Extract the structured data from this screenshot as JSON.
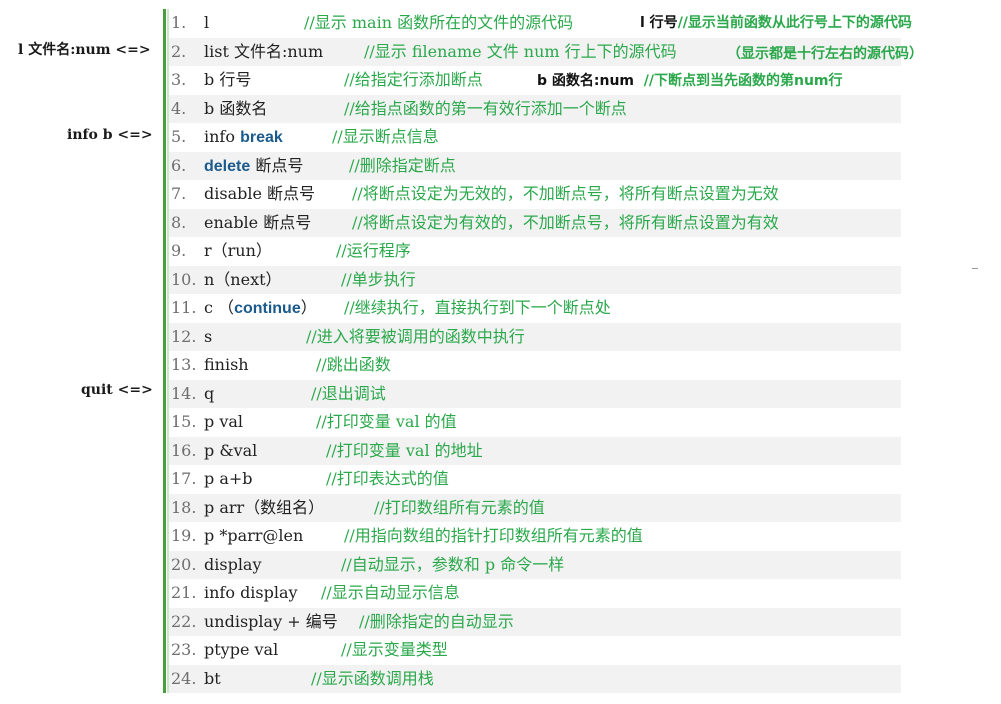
{
  "margin_annotations": {
    "list_alias": "l 文件名:num <=>",
    "info_b_alias": "info b  <=>",
    "quit_alias": "quit  <=>"
  },
  "inline_notes": {
    "line1_cmd": "l  行号",
    "line1_desc": "//显示当前函数从此行号上下的源代码",
    "line2_desc": "（显示都是十行左右的源代码）",
    "line3_cmd": "b 函数名:num",
    "line3_desc": "//下断点到当先函数的第num行"
  },
  "lines": [
    {
      "num": "1.",
      "cmd": "l",
      "comment": "//显示 main 函数所在的文件的源代码"
    },
    {
      "num": "2.",
      "cmd": "list  文件名:num",
      "comment": "//显示 filename 文件 num 行上下的源代码"
    },
    {
      "num": "3.",
      "cmd": "b  行号",
      "comment": "//给指定行添加断点"
    },
    {
      "num": "4.",
      "cmd": "b  函数名",
      "comment": "//给指点函数的第一有效行添加一个断点"
    },
    {
      "num": "5.",
      "cmd_pre": "info  ",
      "keyword": "break",
      "cmd_post": "",
      "comment": "//显示断点信息"
    },
    {
      "num": "6.",
      "cmd_pre": "",
      "keyword": "delete",
      "cmd_post": " 断点号",
      "comment": "//删除指定断点"
    },
    {
      "num": "7.",
      "cmd": "disable  断点号",
      "comment": "//将断点设定为无效的，不加断点号，将所有断点设置为无效"
    },
    {
      "num": "8.",
      "cmd": "enable   断点号",
      "comment": "//将断点设定为有效的，不加断点号，将所有断点设置为有效"
    },
    {
      "num": "9.",
      "cmd": "r（run）",
      "comment": "//运行程序"
    },
    {
      "num": "10.",
      "cmd": "n（next）",
      "comment": "//单步执行"
    },
    {
      "num": "11.",
      "cmd_pre": "c （",
      "keyword": "continue",
      "cmd_post": "）",
      "comment": "//继续执行，直接执行到下一个断点处"
    },
    {
      "num": "12.",
      "cmd": "s",
      "comment": "//进入将要被调用的函数中执行"
    },
    {
      "num": "13.",
      "cmd": "finish",
      "comment": "//跳出函数"
    },
    {
      "num": "14.",
      "cmd": "q",
      "comment": "//退出调试"
    },
    {
      "num": "15.",
      "cmd": "p   val",
      "comment": "//打印变量 val 的值"
    },
    {
      "num": "16.",
      "cmd": "p   &val",
      "comment": "//打印变量 val 的地址"
    },
    {
      "num": "17.",
      "cmd": "p   a+b",
      "comment": "//打印表达式的值"
    },
    {
      "num": "18.",
      "cmd": "p   arr（数组名）",
      "comment": "//打印数组所有元素的值"
    },
    {
      "num": "19.",
      "cmd": "p   *parr@len",
      "comment": "//用指向数组的指针打印数组所有元素的值"
    },
    {
      "num": "20.",
      "cmd": "display",
      "comment": "//自动显示，参数和 p 命令一样"
    },
    {
      "num": "21.",
      "cmd": "info  display",
      "comment": "//显示自动显示信息"
    },
    {
      "num": "22.",
      "cmd": "undisplay + 编号",
      "comment": "//删除指定的自动显示"
    },
    {
      "num": "23.",
      "cmd": "ptype   val",
      "comment": "//显示变量类型"
    },
    {
      "num": "24.",
      "cmd": "bt",
      "comment": "//显示函数调用栈"
    }
  ],
  "colors": {
    "comment_green": "#2aa84b",
    "keyword_blue": "#1b5a8c",
    "rule_green": "#4a9e40",
    "row_alt_bg": "#f2f2f2"
  }
}
